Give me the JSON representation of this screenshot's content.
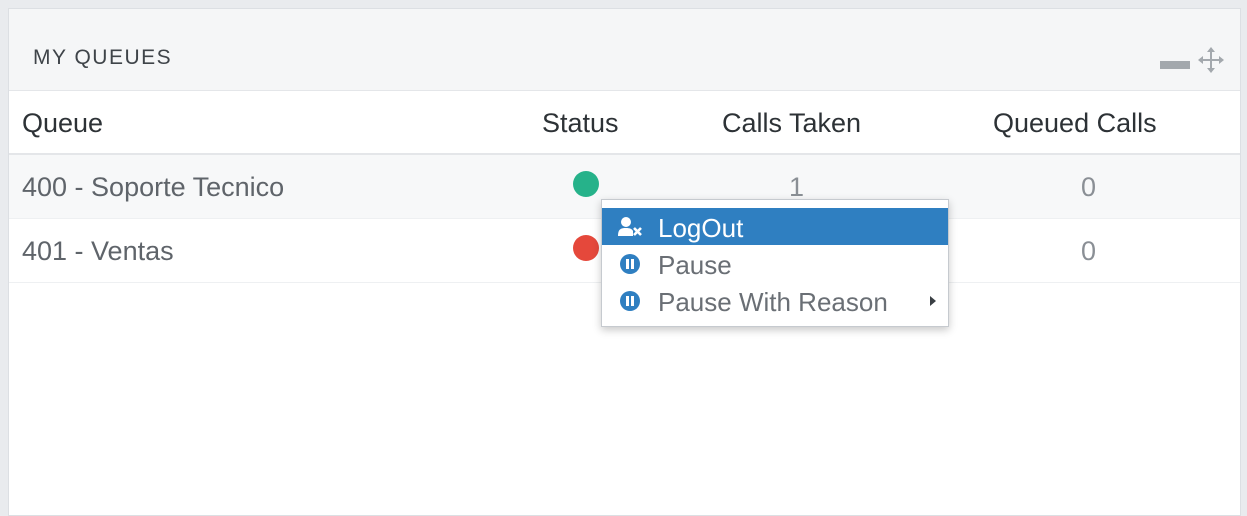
{
  "widget": {
    "title": "MY QUEUES",
    "controls": {
      "minimize_icon": "minimize-icon",
      "move_icon": "move-icon"
    }
  },
  "table": {
    "headers": [
      "Queue",
      "Status",
      "Calls Taken",
      "Queued Calls"
    ],
    "rows": [
      {
        "queue": "400 - Soporte Tecnico",
        "status_color": "#26b28a",
        "calls_taken": "1",
        "queued_calls": "0"
      },
      {
        "queue": "401 - Ventas",
        "status_color": "#e5483b",
        "calls_taken": "",
        "queued_calls": "0"
      }
    ]
  },
  "context_menu": {
    "items": [
      {
        "label": "LogOut",
        "icon": "user-remove-icon",
        "active": true
      },
      {
        "label": "Pause",
        "icon": "pause-circle-icon",
        "active": false
      },
      {
        "label": "Pause With Reason",
        "icon": "pause-circle-icon",
        "active": false,
        "has_submenu": true
      }
    ],
    "accent_color": "#2f7fc1"
  }
}
